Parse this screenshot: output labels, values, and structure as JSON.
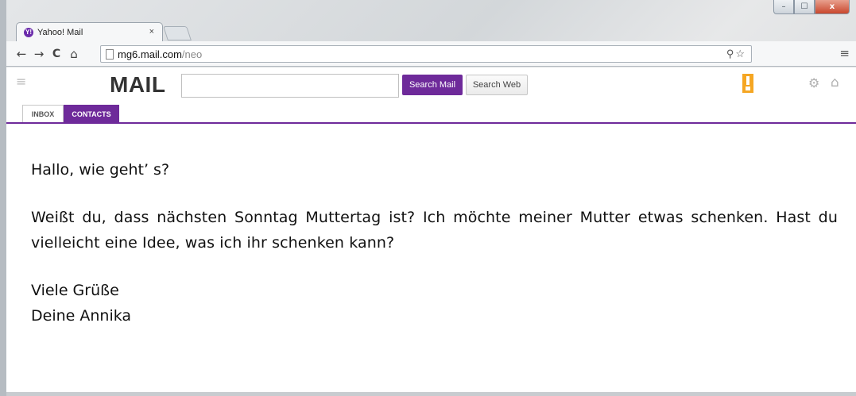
{
  "window": {
    "minimize_label": "–",
    "maximize_label": "☐",
    "close_label": "x"
  },
  "browser": {
    "tab": {
      "favicon_text": "Y!",
      "title": "Yahoo! Mail",
      "close_label": "×"
    },
    "nav": {
      "back": "←",
      "forward": "→",
      "reload": "C",
      "home": "⌂"
    },
    "url": {
      "host": "mg6.mail.com",
      "path": "/neo"
    },
    "omnibox_icons": "⚲☆",
    "menu_label": "≡"
  },
  "mail": {
    "menu_label": "≡",
    "logo": "MAIL",
    "search": {
      "value": "",
      "search_mail_label": "Search Mail",
      "search_web_label": "Search Web"
    },
    "gear_label": "⚙",
    "home_label": "⌂",
    "tabs": [
      {
        "label": "INBOX"
      },
      {
        "label": "CONTACTS"
      }
    ],
    "accent_color": "#6e2a9a",
    "badge_color": "#f5a623"
  },
  "message": {
    "greeting": "Hallo, wie geht’ s?",
    "body": "Weißt du, dass nächsten Sonntag Muttertag ist? Ich möchte meiner Mutter etwas schenken. Hast du vielleicht eine Idee, was ich ihr schenken kann?",
    "closing": "Viele Grüße",
    "signature": "Deine Annika"
  }
}
